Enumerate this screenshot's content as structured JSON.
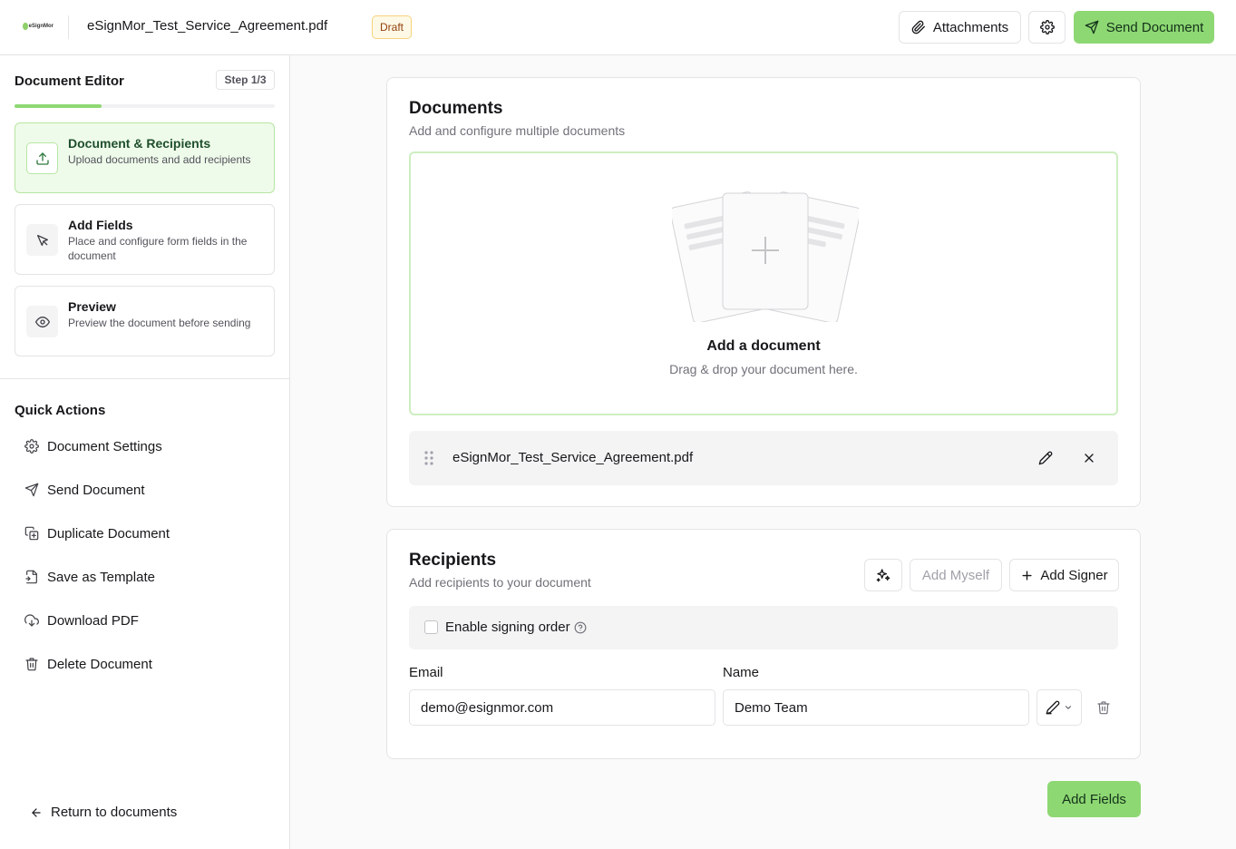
{
  "header": {
    "logo_text": "eSignMor",
    "document_title": "eSignMor_Test_Service_Agreement.pdf",
    "status_badge": "Draft",
    "attachments_label": "Attachments",
    "send_label": "Send Document"
  },
  "sidebar": {
    "title": "Document Editor",
    "step_badge": "Step 1/3",
    "progress": 0.333,
    "steps": [
      {
        "title": "Document & Recipients",
        "description": "Upload documents and add recipients",
        "active": true
      },
      {
        "title": "Add Fields",
        "description": "Place and configure form fields in the document",
        "active": false
      },
      {
        "title": "Preview",
        "description": "Preview the document before sending",
        "active": false
      }
    ],
    "quick_actions_title": "Quick Actions",
    "quick_actions": [
      {
        "label": "Document Settings",
        "icon": "gear-icon"
      },
      {
        "label": "Send Document",
        "icon": "send-icon"
      },
      {
        "label": "Duplicate Document",
        "icon": "duplicate-icon"
      },
      {
        "label": "Save as Template",
        "icon": "template-icon"
      },
      {
        "label": "Download PDF",
        "icon": "download-icon"
      },
      {
        "label": "Delete Document",
        "icon": "trash-icon"
      }
    ],
    "return_label": "Return to documents"
  },
  "documents": {
    "title": "Documents",
    "subtitle": "Add and configure multiple documents",
    "dropzone_title": "Add a document",
    "dropzone_subtitle": "Drag & drop your document here.",
    "files": [
      {
        "name": "eSignMor_Test_Service_Agreement.pdf"
      }
    ]
  },
  "recipients": {
    "title": "Recipients",
    "subtitle": "Add recipients to your document",
    "add_myself_label": "Add Myself",
    "add_signer_label": "Add Signer",
    "signing_order_label": "Enable signing order",
    "signing_order_enabled": false,
    "email_label": "Email",
    "name_label": "Name",
    "signers": [
      {
        "email": "demo@esignmor.com",
        "name": "Demo Team",
        "role_icon": "pen-icon"
      }
    ]
  },
  "footer": {
    "add_fields_label": "Add Fields"
  },
  "colors": {
    "accent": "#8ed873",
    "accent_light": "#effbea",
    "draft_badge_bg": "#fef9e7"
  }
}
